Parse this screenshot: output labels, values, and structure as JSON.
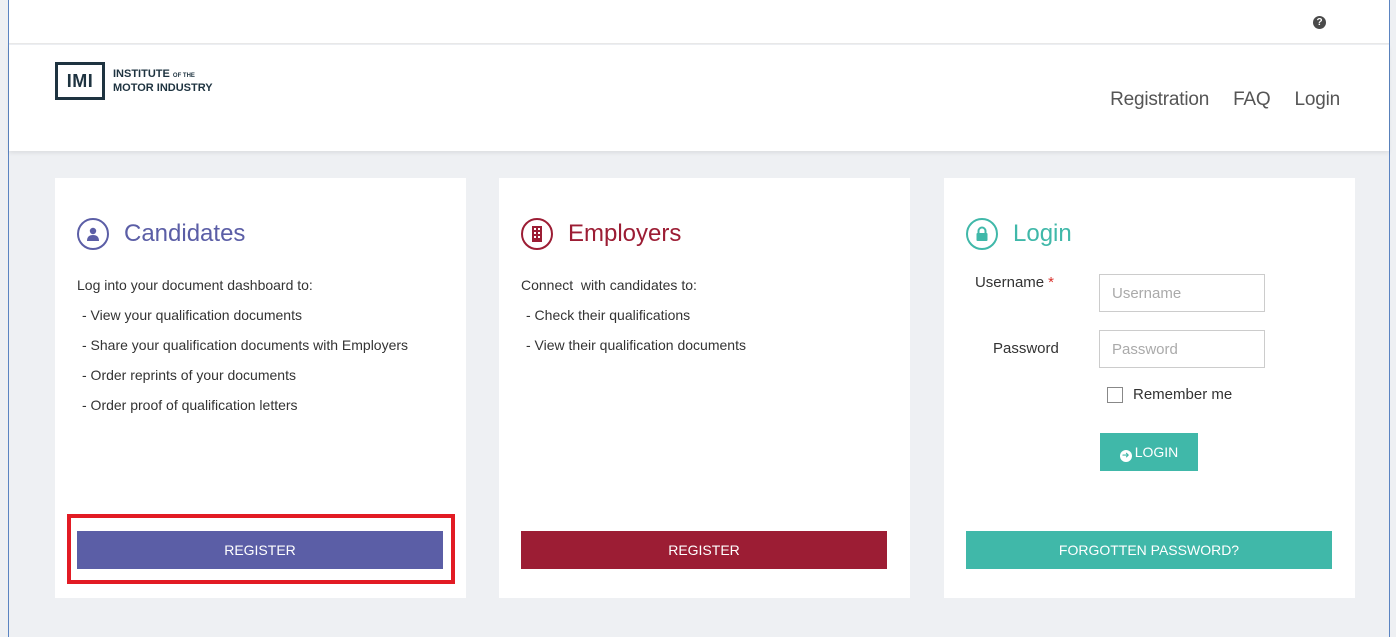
{
  "topbar": {
    "help_icon": "question-circle-icon",
    "help_glyph": "?"
  },
  "logo": {
    "mark": "IMI",
    "line1": "INSTITUTE",
    "line1_small": "OF THE",
    "line2": "MOTOR INDUSTRY"
  },
  "nav": {
    "items": [
      "Registration",
      "FAQ",
      "Login"
    ]
  },
  "colors": {
    "candidates": "#5b5ea6",
    "employers": "#9c1d34",
    "login": "#40b8a9"
  },
  "candidates": {
    "title": "Candidates",
    "icon": "user-icon",
    "intro": "Log into your document dashboard to:",
    "items": [
      "- View your qualification documents",
      "- Share your qualification documents with Employers",
      "- Order reprints of your documents",
      "- Order proof of qualification letters"
    ],
    "button": "REGISTER"
  },
  "employers": {
    "title": "Employers",
    "icon": "building-icon",
    "intro": "Connect  with candidates to:",
    "items": [
      "- Check their qualifications",
      "- View their qualification documents"
    ],
    "button": "REGISTER"
  },
  "login": {
    "title": "Login",
    "icon": "lock-icon",
    "username_label": "Username",
    "required_mark": "*",
    "username_placeholder": "Username",
    "password_label": "Password",
    "password_placeholder": "Password",
    "remember_label": "Remember me",
    "login_button": "LOGIN",
    "forgot_button": "FORGOTTEN PASSWORD?"
  }
}
